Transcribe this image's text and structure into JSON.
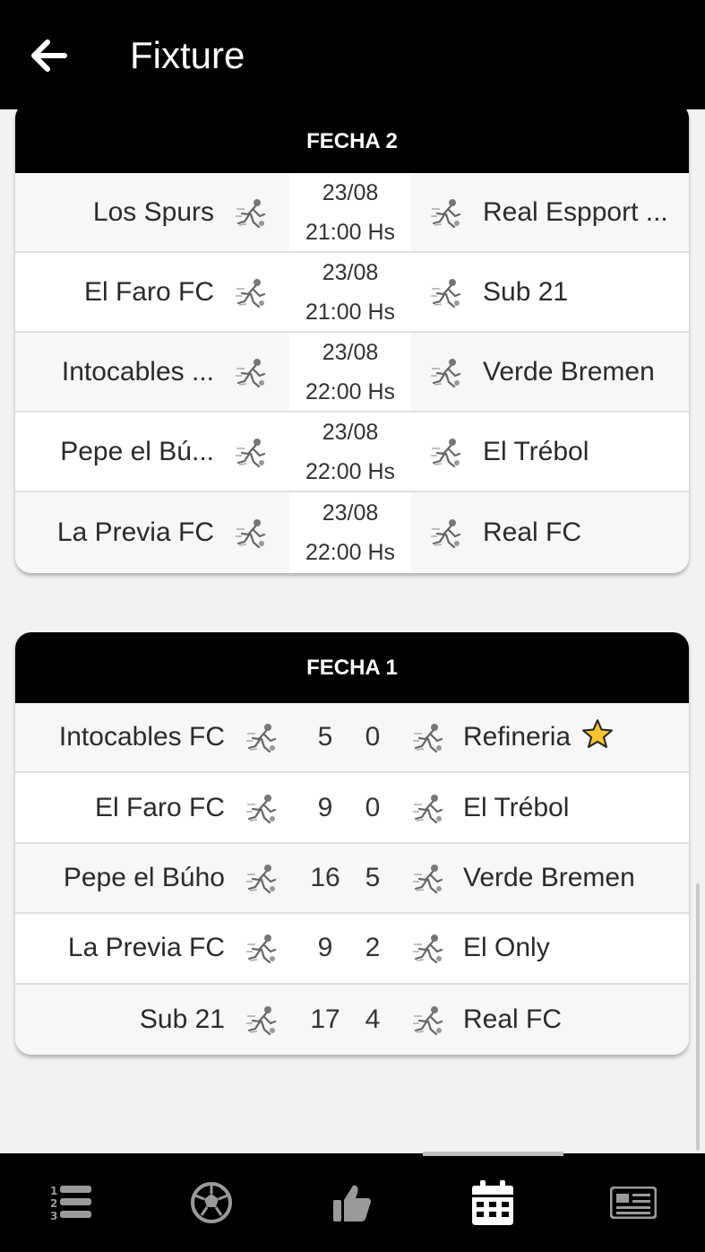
{
  "app_bar": {
    "title": "Fixture",
    "back_icon": "arrow-left-icon"
  },
  "colors": {
    "header": "#000000",
    "background": "#f2f2f2",
    "star": "#f5c431"
  },
  "fecha2": {
    "title": "FECHA 2",
    "rows": [
      {
        "home": "Los Spurs",
        "date": "23/08",
        "time": "21:00 Hs",
        "away": "Real Espport ..."
      },
      {
        "home": "El Faro FC",
        "date": "23/08",
        "time": "21:00 Hs",
        "away": "Sub 21"
      },
      {
        "home": "Intocables ...",
        "date": "23/08",
        "time": "22:00 Hs",
        "away": "Verde Bremen"
      },
      {
        "home": "Pepe el Bú...",
        "date": "23/08",
        "time": "22:00 Hs",
        "away": "El Trébol"
      },
      {
        "home": "La Previa FC",
        "date": "23/08",
        "time": "22:00 Hs",
        "away": "Real FC"
      }
    ]
  },
  "fecha1": {
    "title": "FECHA 1",
    "rows": [
      {
        "home": "Intocables FC",
        "home_score": "5",
        "away_score": "0",
        "away": "Refineria",
        "favorite": true
      },
      {
        "home": "El Faro FC",
        "home_score": "9",
        "away_score": "0",
        "away": "El Trébol"
      },
      {
        "home": "Pepe el Búho",
        "home_score": "16",
        "away_score": "5",
        "away": "Verde Bremen"
      },
      {
        "home": "La Previa FC",
        "home_score": "9",
        "away_score": "2",
        "away": "El Only"
      },
      {
        "home": "Sub 21",
        "home_score": "17",
        "away_score": "4",
        "away": "Real FC"
      }
    ]
  },
  "bottom_nav": [
    {
      "icon": "ranking-list-icon"
    },
    {
      "icon": "soccer-ball-icon"
    },
    {
      "icon": "thumbs-up-icon"
    },
    {
      "icon": "calendar-icon",
      "active": true
    },
    {
      "icon": "newspaper-icon"
    }
  ]
}
